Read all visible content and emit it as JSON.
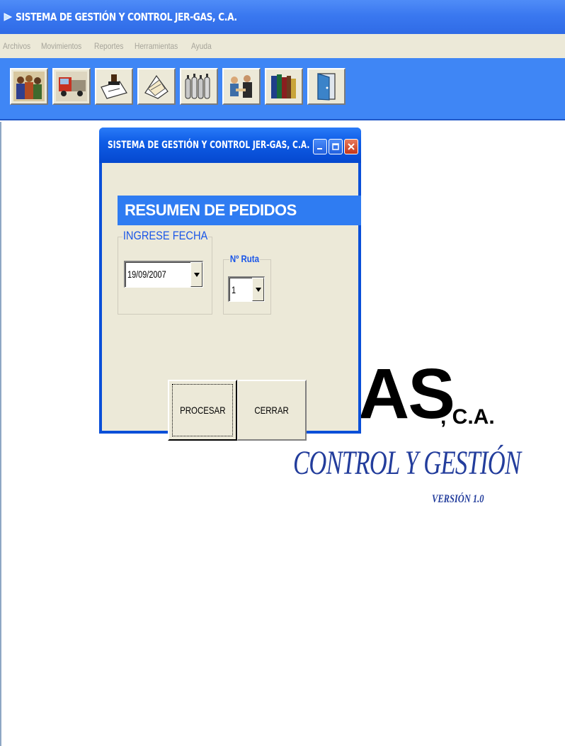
{
  "main_window": {
    "title": "SISTEMA DE GESTIÓN Y CONTROL JER-GAS, C.A."
  },
  "menu": {
    "items": [
      "Archivos",
      "Movimientos",
      "Reportes",
      "Herramientas",
      "Ayuda"
    ]
  },
  "toolbar": {
    "buttons": [
      {
        "icon": "workers-icon"
      },
      {
        "icon": "truck-icon"
      },
      {
        "icon": "document-stamp-icon"
      },
      {
        "icon": "papers-icon"
      },
      {
        "icon": "gas-cylinders-icon"
      },
      {
        "icon": "meeting-icon"
      },
      {
        "icon": "books-icon"
      },
      {
        "icon": "exit-door-icon"
      }
    ]
  },
  "background_logo": {
    "gas_text": "AS",
    "ca_text": ", C.A.",
    "tagline": "CONTROL Y GESTIÓN",
    "version": "VERSIÓN 1.0"
  },
  "dialog": {
    "title": "SISTEMA DE GESTIÓN Y CONTROL JER-GAS, C.A.",
    "banner": "RESUMEN DE PEDIDOS",
    "fecha_group": {
      "legend": "INGRESE FECHA",
      "value": "19/09/2007"
    },
    "ruta_group": {
      "legend": "Nº Ruta",
      "value": "1"
    },
    "procesar_label": "PROCESAR",
    "cerrar_label": "CERRAR"
  },
  "colors": {
    "title_bar_blue": "#3a78f0",
    "toolbar_blue": "#3f86f5",
    "banner_blue": "#2f7cf2",
    "legend_blue": "#1a56e8",
    "logo_navy": "#233d9c",
    "window_face": "#ece9d8"
  }
}
